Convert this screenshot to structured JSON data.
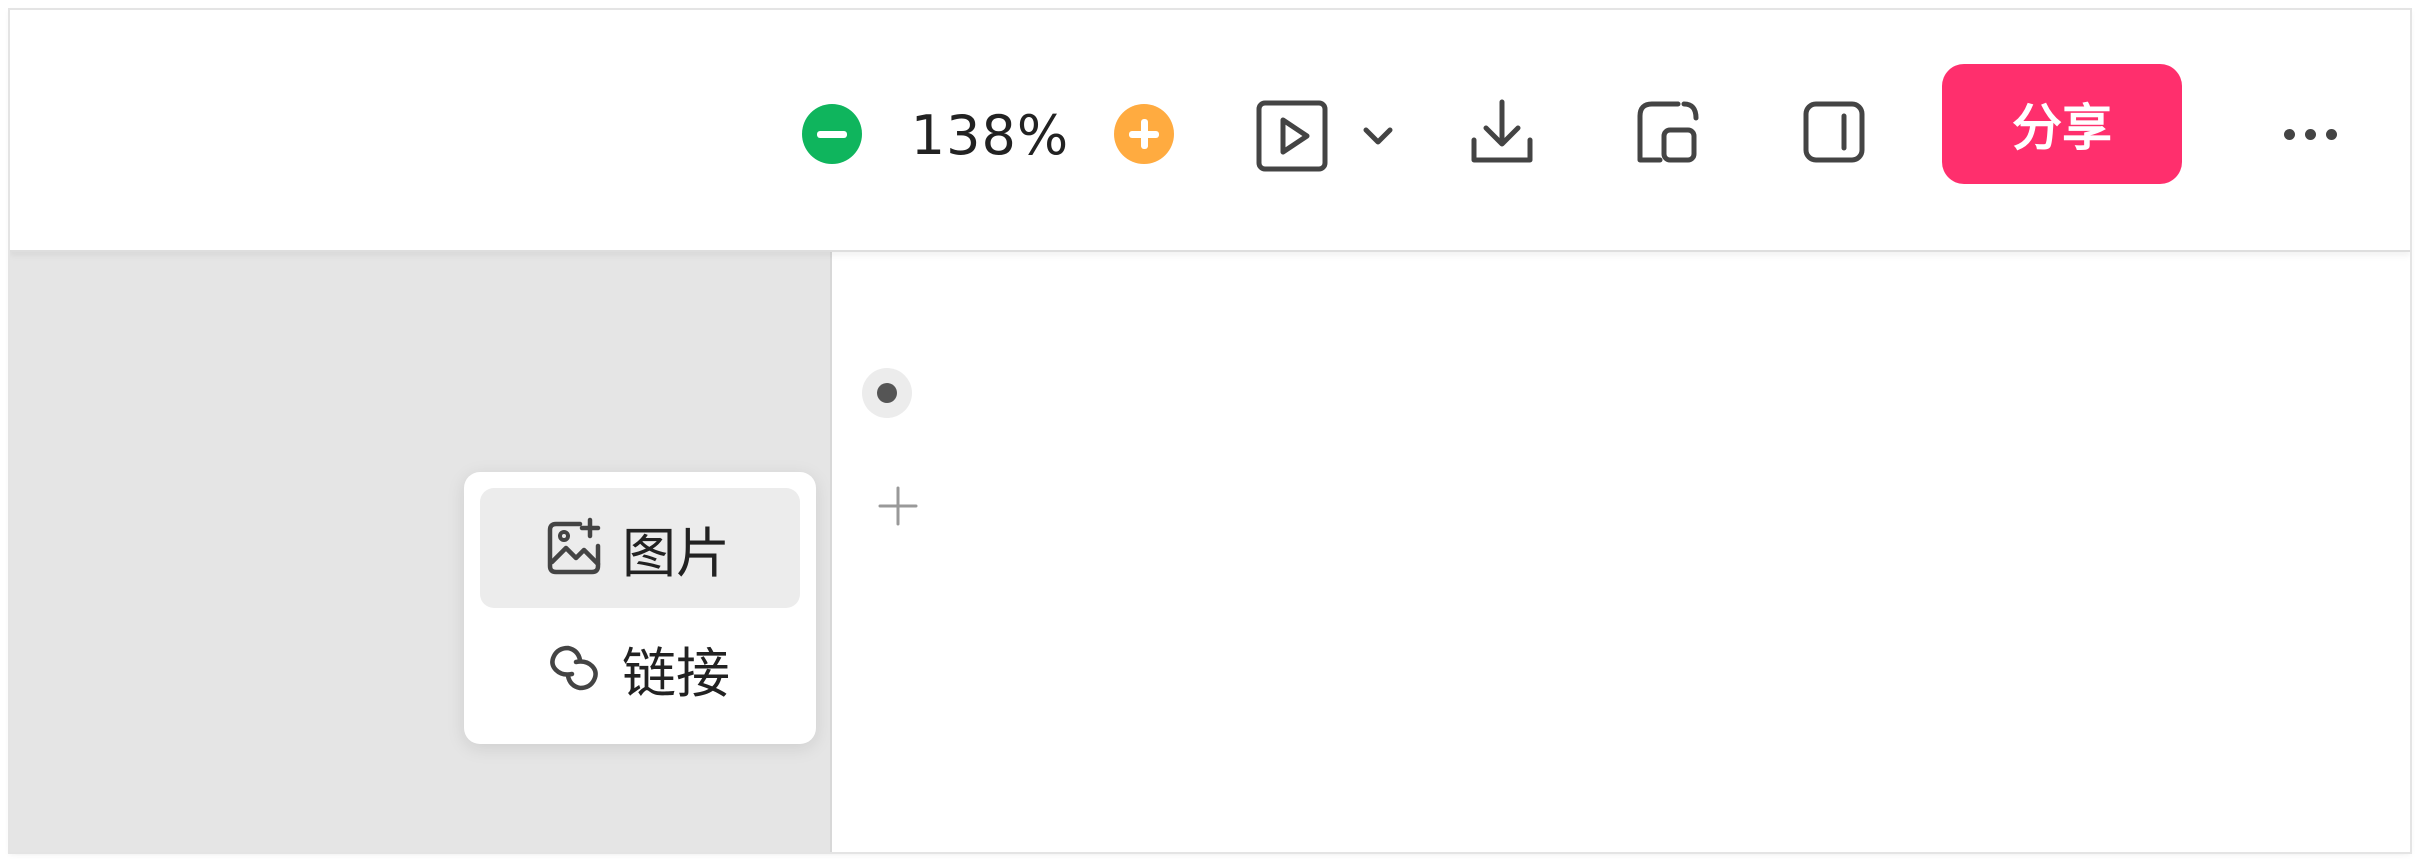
{
  "toolbar": {
    "zoom_level": "138%",
    "zoom_out_icon": "minus-circle-icon",
    "zoom_in_icon": "plus-circle-icon",
    "present_icon": "play-square-icon",
    "present_dropdown_icon": "chevron-down-icon",
    "download_icon": "download-icon",
    "ratio_icon": "frame-icon",
    "panel_icon": "sidebar-panel-icon",
    "share_label": "分享",
    "more_icon": "more-horizontal-icon"
  },
  "insert_menu": {
    "items": [
      {
        "label": "图片",
        "icon": "image-add-icon"
      },
      {
        "label": "链接",
        "icon": "link-icon"
      }
    ]
  },
  "colors": {
    "zoom_out": "#0fb55d",
    "zoom_in": "#ffab40",
    "share": "#ff2f6d",
    "sidebar_bg": "#e5e5e5"
  }
}
